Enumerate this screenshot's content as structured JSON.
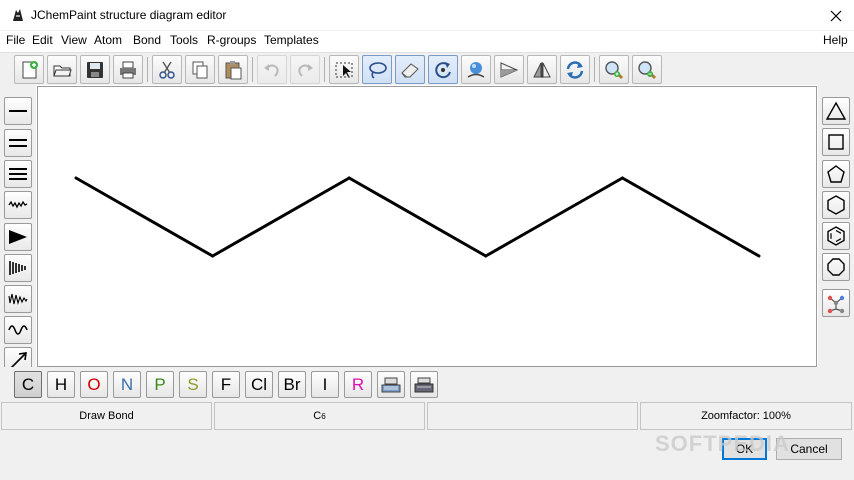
{
  "window": {
    "title": "JChemPaint structure diagram editor"
  },
  "menu": [
    "File",
    "Edit",
    "View",
    "Atom",
    "Bond",
    "Tools",
    "R-groups",
    "Templates"
  ],
  "menu_help": "Help",
  "toolbar_icons": [
    "new-icon",
    "open-icon",
    "save-icon",
    "print-icon",
    "cut-icon",
    "copy-icon",
    "paste-icon",
    "undo-icon",
    "redo-icon",
    "select-rect-icon",
    "lasso-icon",
    "eraser-icon",
    "rotate-icon",
    "cleanup-icon",
    "flip-horizontal-icon",
    "flip-vertical-icon",
    "refresh-icon",
    "zoom-in-icon",
    "zoom-out-icon"
  ],
  "bond_tools": [
    "single-bond-icon",
    "double-bond-icon",
    "triple-bond-icon",
    "wavy-bond-icon",
    "wedge-up-icon",
    "wedge-down-icon",
    "zigzag-bond-icon",
    "wave-bond-icon",
    "arrow-icon"
  ],
  "ring_tools": [
    "triangle-ring-icon",
    "square-ring-icon",
    "pentagon-ring-icon",
    "hexagon-ring-icon",
    "benzene-ring-icon",
    "octagon-ring-icon",
    "template-ring-icon"
  ],
  "atoms": [
    {
      "symbol": "C",
      "color": "#000000"
    },
    {
      "symbol": "H",
      "color": "#000000"
    },
    {
      "symbol": "O",
      "color": "#d40000"
    },
    {
      "symbol": "N",
      "color": "#3a6fa8"
    },
    {
      "symbol": "P",
      "color": "#3a8a1a"
    },
    {
      "symbol": "S",
      "color": "#8c9a2a"
    },
    {
      "symbol": "F",
      "color": "#000000"
    },
    {
      "symbol": "Cl",
      "color": "#000000"
    },
    {
      "symbol": "Br",
      "color": "#000000"
    },
    {
      "symbol": "I",
      "color": "#000000"
    },
    {
      "symbol": "R",
      "color": "#e010b0"
    }
  ],
  "atom_extra_icons": [
    "periodic-table-icon",
    "element-list-icon"
  ],
  "status": {
    "mode": "Draw Bond",
    "formula_base": "C",
    "formula_sub": "6",
    "empty": "",
    "zoom": "Zoomfactor: 100%"
  },
  "buttons": {
    "ok": "OK",
    "cancel": "Cancel"
  },
  "watermark": "SOFTPEDIA",
  "molecule": {
    "atoms": [
      [
        0,
        0
      ],
      [
        1,
        1
      ],
      [
        2,
        0
      ],
      [
        3,
        1
      ],
      [
        4,
        0
      ],
      [
        5,
        1
      ]
    ],
    "bonds": [
      [
        0,
        1
      ],
      [
        1,
        2
      ],
      [
        2,
        3
      ],
      [
        3,
        4
      ],
      [
        4,
        5
      ]
    ]
  }
}
